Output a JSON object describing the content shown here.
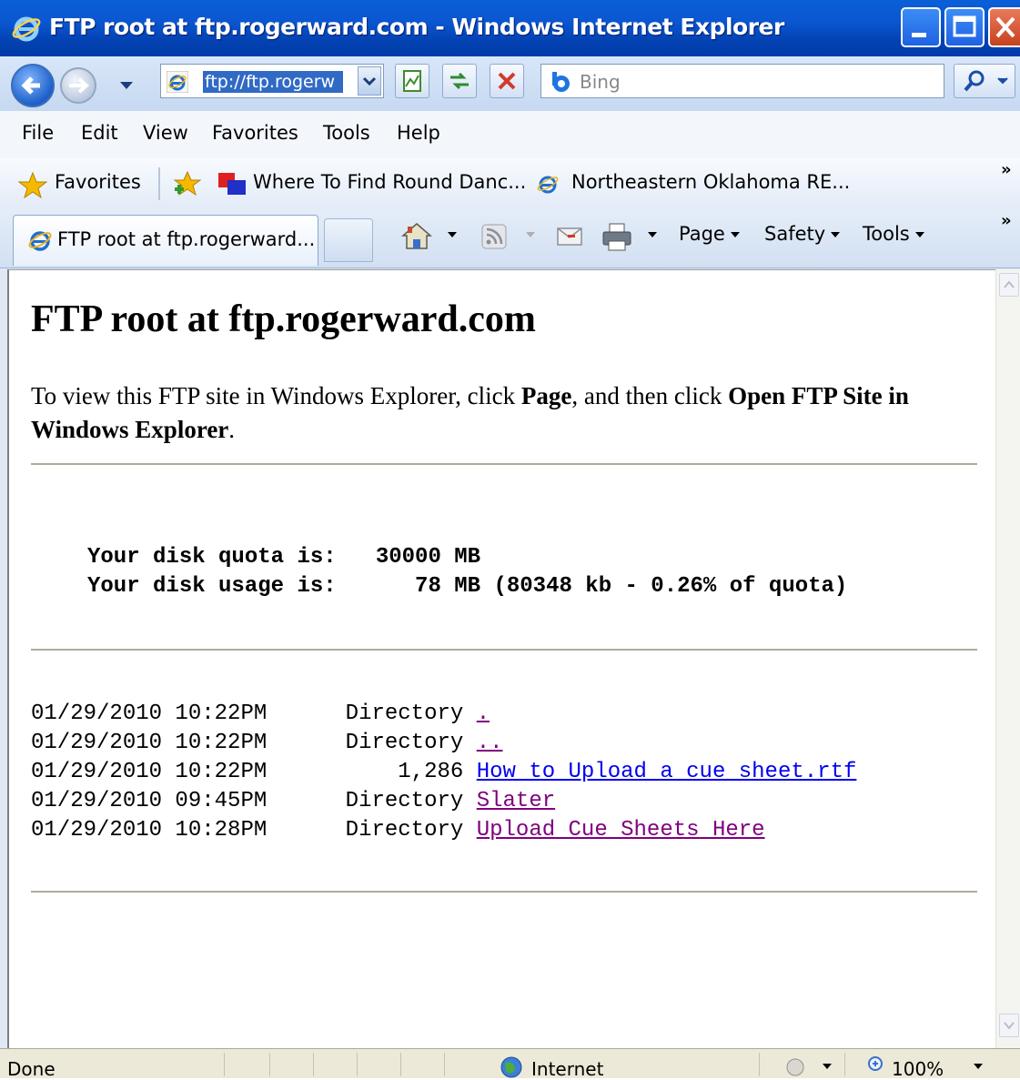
{
  "window": {
    "title": "FTP root at ftp.rogerward.com - Windows Internet Explorer"
  },
  "address_bar": {
    "url": "ftp://ftp.rogerward.com/",
    "url_visible": "ftp://ftp.rogerw"
  },
  "search": {
    "placeholder": "Bing"
  },
  "menu": [
    "File",
    "Edit",
    "View",
    "Favorites",
    "Tools",
    "Help"
  ],
  "favorites_bar": {
    "favorites_label": "Favorites",
    "links": [
      "Where To Find Round Danc...",
      "Northeastern Oklahoma RE..."
    ]
  },
  "tab": {
    "label": "FTP root at ftp.rogerward..."
  },
  "command_bar": {
    "page": "Page",
    "safety": "Safety",
    "tools": "Tools"
  },
  "page": {
    "heading": "FTP root at ftp.rogerward.com",
    "intro_prefix": "To view this FTP site in Windows Explorer, click ",
    "intro_bold1": "Page",
    "intro_middle": ", and then click ",
    "intro_bold2": "Open FTP Site in Windows Explorer",
    "intro_suffix": ".",
    "quota_line1": "Your disk quota is:   30000 MB",
    "quota_line2": "Your disk usage is:      78 MB (80348 kb - 0.26% of quota)",
    "listing": [
      {
        "date": "01/29/2010 10:22PM",
        "size": "Directory",
        "name": ".",
        "visited": true
      },
      {
        "date": "01/29/2010 10:22PM",
        "size": "Directory",
        "name": "..",
        "visited": true
      },
      {
        "date": "01/29/2010 10:22PM",
        "size": "    1,286",
        "name": "How to Upload a cue sheet.rtf",
        "visited": false
      },
      {
        "date": "01/29/2010 09:45PM",
        "size": "Directory",
        "name": "Slater",
        "visited": true
      },
      {
        "date": "01/29/2010 10:28PM",
        "size": "Directory",
        "name": "Upload Cue Sheets Here",
        "visited": true
      }
    ]
  },
  "status_bar": {
    "status": "Done",
    "zone": "Internet",
    "zoom": "100%"
  },
  "colors": {
    "link": "#0000ee",
    "visited_link": "#800080",
    "titlebar": "#0a56d0"
  }
}
